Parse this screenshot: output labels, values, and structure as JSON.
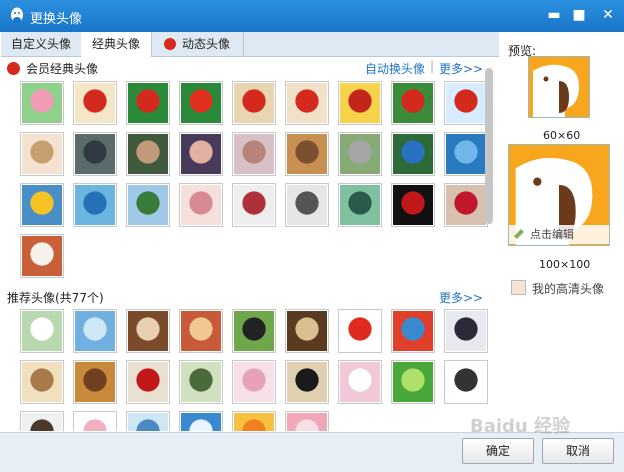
{
  "window": {
    "title": "更换头像"
  },
  "tabs": [
    {
      "label": "自定义头像"
    },
    {
      "label": "经典头像"
    },
    {
      "label": "动态头像"
    }
  ],
  "classic_section": {
    "title": "会员经典头像",
    "auto_change": "自动换头像",
    "more": "更多>>",
    "thumbs": [
      {
        "name": "pink-pig",
        "c1": "#8fd18a",
        "c2": "#f29bb6"
      },
      {
        "name": "red-fox-reading",
        "c1": "#f5e6c8",
        "c2": "#d42a1e"
      },
      {
        "name": "red-fox-present",
        "c1": "#2a8a3a",
        "c2": "#d42a1e"
      },
      {
        "name": "red-fox-christmas",
        "c1": "#2a8a3a",
        "c2": "#e0301e"
      },
      {
        "name": "red-fox-tower",
        "c1": "#e8d6b0",
        "c2": "#d42a1e"
      },
      {
        "name": "red-fox-cafe",
        "c1": "#f1e1c8",
        "c2": "#d42a1e"
      },
      {
        "name": "red-fox-glasses",
        "c1": "#f6d34a",
        "c2": "#c2251a"
      },
      {
        "name": "red-fox-house",
        "c1": "#3a8c3a",
        "c2": "#d42a1e"
      },
      {
        "name": "red-fox-mask",
        "c1": "#d8ecff",
        "c2": "#d42a1e"
      },
      {
        "name": "anime-girl-blonde",
        "c1": "#f3e2cf",
        "c2": "#c8a070"
      },
      {
        "name": "anime-boy-dark",
        "c1": "#5b6a6b",
        "c2": "#2f3b40"
      },
      {
        "name": "warrior-green",
        "c1": "#3f5a3c",
        "c2": "#c09a7a"
      },
      {
        "name": "anime-girl-purple",
        "c1": "#4a3a5a",
        "c2": "#e0b0a0"
      },
      {
        "name": "fairy-pink",
        "c1": "#d8c0c8",
        "c2": "#b8847a"
      },
      {
        "name": "anime-girl-fire",
        "c1": "#c89050",
        "c2": "#7a5030"
      },
      {
        "name": "koala",
        "c1": "#88aa77",
        "c2": "#a6a6a6"
      },
      {
        "name": "blue-parrot",
        "c1": "#2d6a3a",
        "c2": "#2a70c0"
      },
      {
        "name": "blue-bird",
        "c1": "#2a7ac0",
        "c2": "#6fb7e8"
      },
      {
        "name": "yellow-bird",
        "c1": "#4a8ec8",
        "c2": "#f6c324"
      },
      {
        "name": "blue-birds-pair",
        "c1": "#6bb5e0",
        "c2": "#2570b8"
      },
      {
        "name": "penguin-flying",
        "c1": "#9fc7e6",
        "c2": "#3a7a3a"
      },
      {
        "name": "lips-pink",
        "c1": "#f6e0dc",
        "c2": "#d88a94"
      },
      {
        "name": "girl-red-bow",
        "c1": "#eee",
        "c2": "#b0303a"
      },
      {
        "name": "girl-monochrome",
        "c1": "#e6e6e6",
        "c2": "#555"
      },
      {
        "name": "girl-green-hair",
        "c1": "#7fc0a0",
        "c2": "#2a5a4a"
      },
      {
        "name": "red-lips-girl",
        "c1": "#111",
        "c2": "#c01818"
      },
      {
        "name": "red-lips-bite",
        "c1": "#d8c0b0",
        "c2": "#c0182a"
      },
      {
        "name": "mr-right-egg",
        "c1": "#c9603a",
        "c2": "#f7f2ea"
      }
    ]
  },
  "recommended_section": {
    "title": "推荐头像(共77个)",
    "more": "更多>>",
    "thumbs": [
      {
        "name": "profile-sketch",
        "c1": "#b8d8b0",
        "c2": "#fff"
      },
      {
        "name": "blue-sky-smile",
        "c1": "#6fb0e0",
        "c2": "#cfe8f8"
      },
      {
        "name": "coffee-heart",
        "c1": "#7a4a2a",
        "c2": "#e8d0b0"
      },
      {
        "name": "opera-mask",
        "c1": "#c85a3a",
        "c2": "#f0c890"
      },
      {
        "name": "penguin-grass",
        "c1": "#6fa84a",
        "c2": "#222"
      },
      {
        "name": "latte-art",
        "c1": "#5a3a20",
        "c2": "#d8c090"
      },
      {
        "name": "red-cartoon",
        "c1": "#fff",
        "c2": "#e02a1e"
      },
      {
        "name": "colored-pencils",
        "c1": "#e0402a",
        "c2": "#3a8ad0"
      },
      {
        "name": "seal-sleeping",
        "c1": "#e8e8f0",
        "c2": "#2a2a3a"
      },
      {
        "name": "sandwich-cup",
        "c1": "#f0e0c0",
        "c2": "#a87a4a"
      },
      {
        "name": "compass-clock",
        "c1": "#c88a3a",
        "c2": "#704020"
      },
      {
        "name": "opera-face-red",
        "c1": "#e8e0d0",
        "c2": "#c01818"
      },
      {
        "name": "hummingbird",
        "c1": "#d0e0c0",
        "c2": "#4a6a3a"
      },
      {
        "name": "pink-ghost",
        "c1": "#f8e0e8",
        "c2": "#e6a0b8"
      },
      {
        "name": "penguins-dark",
        "c1": "#e0d0b0",
        "c2": "#1a1a1a"
      },
      {
        "name": "pink-flower-frame",
        "c1": "#f0c8d8",
        "c2": "#fff"
      },
      {
        "name": "green-bamboo",
        "c1": "#4aa83a",
        "c2": "#aee06a"
      },
      {
        "name": "penguin-small",
        "c1": "#fff",
        "c2": "#333"
      },
      {
        "name": "dark-tree",
        "c1": "#f0f0f0",
        "c2": "#4a3a2a"
      },
      {
        "name": "pink-glow",
        "c1": "#fff",
        "c2": "#f0b0c0"
      },
      {
        "name": "sea-sky",
        "c1": "#cfe6f4",
        "c2": "#4a8ac0"
      },
      {
        "name": "snowflake-blue",
        "c1": "#3a8ad0",
        "c2": "#e8f4ff"
      },
      {
        "name": "orange-sun",
        "c1": "#f8c040",
        "c2": "#f08020"
      },
      {
        "name": "pink-petals",
        "c1": "#f0a8b8",
        "c2": "#f8e0e8"
      }
    ]
  },
  "preview": {
    "label": "预览:",
    "small_size": "60×60",
    "large_size": "100×100",
    "edit_label": "点击编辑",
    "hd_label": "我的高清头像",
    "avatar_bg": "#f7a61e",
    "avatar_fg": "#ffffff",
    "avatar_dark": "#6a3a1a"
  },
  "buttons": {
    "ok": "确定",
    "cancel": "取消"
  },
  "watermark": "Baidu 经验"
}
